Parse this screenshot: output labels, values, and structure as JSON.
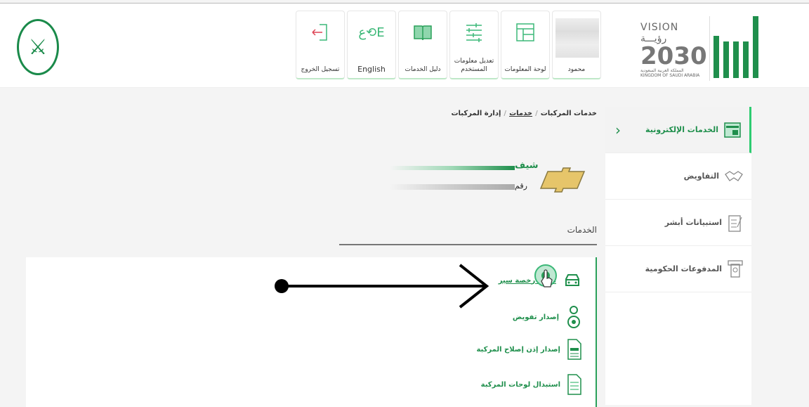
{
  "header": {
    "tiles": [
      {
        "label": "محمود",
        "icon": "user-avatar-blurred"
      },
      {
        "label": "لوحة المعلومات",
        "icon": "dashboard-icon"
      },
      {
        "label": "تعديل معلومات المستخدم",
        "icon": "sliders-icon"
      },
      {
        "label": "دليل الخدمات",
        "icon": "book-icon"
      },
      {
        "label": "English",
        "icon": "language-icon"
      },
      {
        "label": "تسجيل الخروج",
        "icon": "logout-icon"
      }
    ],
    "vision": {
      "line1": "VISION رؤيـــة",
      "line2": "2030",
      "line3": "المملكة العربية السعودية",
      "line4": "KINGDOM OF SAUDI ARABIA"
    },
    "logo": "أبشر"
  },
  "breadcrumb": [
    "خدمات المركبات",
    "خدمات",
    "إدارة المركبات"
  ],
  "vehicle": {
    "name": "شيف",
    "number_label": "رقم"
  },
  "services_title": "الخدمات",
  "services": [
    {
      "label": "تجديد رخصة سير",
      "icon": "car-icon"
    },
    {
      "label": "إصدار تفويض",
      "icon": "driver-icon"
    },
    {
      "label": "إصدار إذن إصلاح المركبة",
      "icon": "repair-document-icon"
    },
    {
      "label": "استبدال لوحات المركبة",
      "icon": "plate-document-icon"
    }
  ],
  "sidebar": [
    {
      "label": "الخدمات الإلكترونية",
      "icon": "eservices-icon",
      "active": true
    },
    {
      "label": "التفاويض",
      "icon": "handshake-icon"
    },
    {
      "label": "استبيانات أبشر",
      "icon": "clipboard-icon"
    },
    {
      "label": "المدفوعات الحكومية",
      "icon": "payment-icon"
    }
  ],
  "colors": {
    "accent": "#1f8f4c",
    "logout": "#c0392b"
  }
}
